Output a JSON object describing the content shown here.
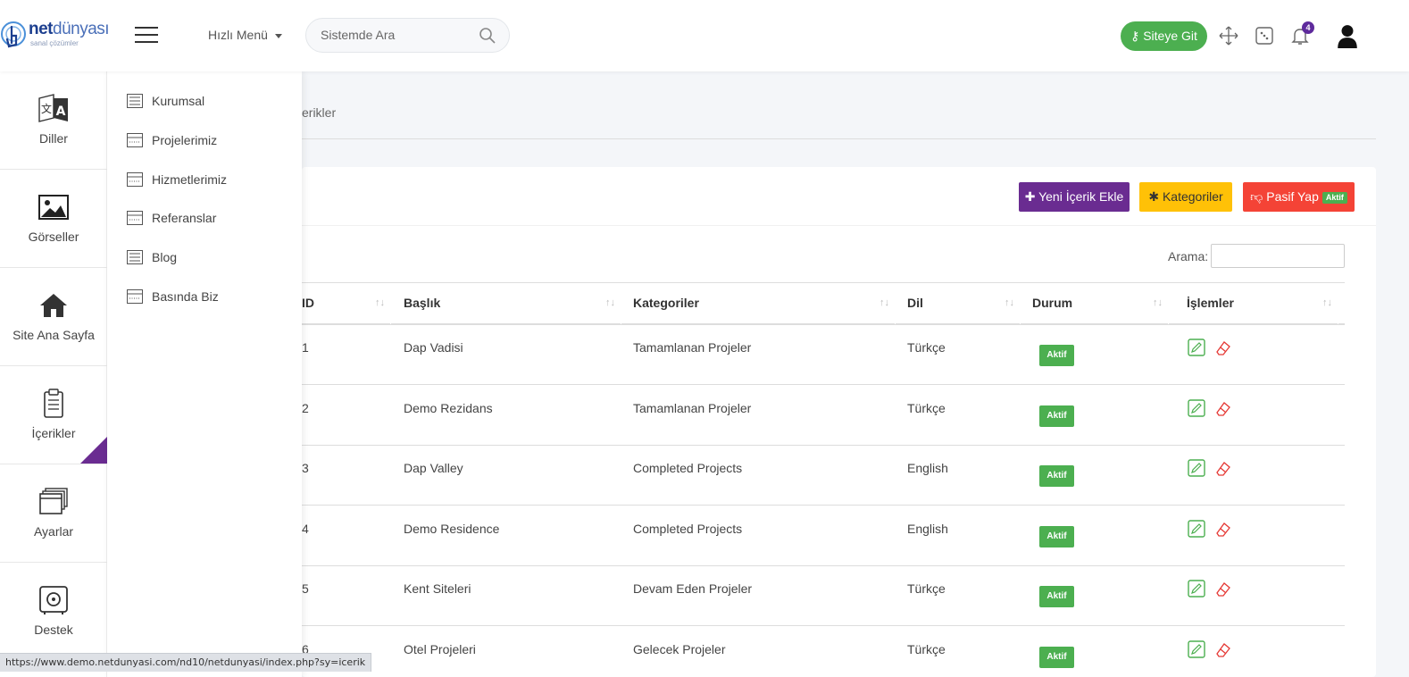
{
  "logo": {
    "brand_bold": "net",
    "brand_rest": "dünyası",
    "tagline": "sanal çözümler"
  },
  "header": {
    "quick_menu": "Hızlı Menü",
    "search_placeholder": "Sistemde Ara",
    "site_button": "Siteye Git",
    "notification_count": "4"
  },
  "sidebar": {
    "items": [
      {
        "label": "Diller",
        "icon": "translate-icon"
      },
      {
        "label": "Görseller",
        "icon": "image-icon"
      },
      {
        "label": "Site Ana Sayfa",
        "icon": "home-icon"
      },
      {
        "label": "İçerikler",
        "icon": "clipboard-icon",
        "active": true
      },
      {
        "label": "Ayarlar",
        "icon": "windows-icon"
      },
      {
        "label": "Destek",
        "icon": "safe-icon"
      }
    ]
  },
  "submenu": {
    "items": [
      {
        "label": "Kurumsal"
      },
      {
        "label": "Projelerimiz"
      },
      {
        "label": "Hizmetlerimiz"
      },
      {
        "label": "Referanslar"
      },
      {
        "label": "Blog"
      },
      {
        "label": "Basında Biz"
      }
    ]
  },
  "breadcrumb": {
    "text": "erikler"
  },
  "toolbar": {
    "new_label": "Yeni İçerik Ekle",
    "categories_label": "Kategoriler",
    "pasif_label": "Pasif Yap",
    "pasif_badge": "Aktif"
  },
  "search": {
    "label": "Arama:"
  },
  "table": {
    "headers": [
      "ID",
      "Başlık",
      "Kategoriler",
      "Dil",
      "Durum",
      "İşlemler"
    ],
    "rows": [
      {
        "id": "1",
        "title": "Dap Vadisi",
        "category": "Tamamlanan Projeler",
        "lang": "Türkçe",
        "status": "Aktif"
      },
      {
        "id": "2",
        "title": "Demo Rezidans",
        "category": "Tamamlanan Projeler",
        "lang": "Türkçe",
        "status": "Aktif"
      },
      {
        "id": "3",
        "title": "Dap Valley",
        "category": "Completed Projects",
        "lang": "English",
        "status": "Aktif"
      },
      {
        "id": "4",
        "title": "Demo Residence",
        "category": "Completed Projects",
        "lang": "English",
        "status": "Aktif"
      },
      {
        "id": "5",
        "title": "Kent Siteleri",
        "category": "Devam Eden Projeler",
        "lang": "Türkçe",
        "status": "Aktif"
      },
      {
        "id": "6",
        "title": "Otel Projeleri",
        "category": "Gelecek Projeler",
        "lang": "Türkçe",
        "status": "Aktif"
      }
    ]
  },
  "status_bar": {
    "url": "https://www.demo.netdunyasi.com/nd10/netdunyasi/index.php?sy=icerik"
  },
  "colors": {
    "purple": "#6a2c91",
    "green": "#4caf50",
    "yellow": "#ffc107",
    "red": "#f44336"
  }
}
